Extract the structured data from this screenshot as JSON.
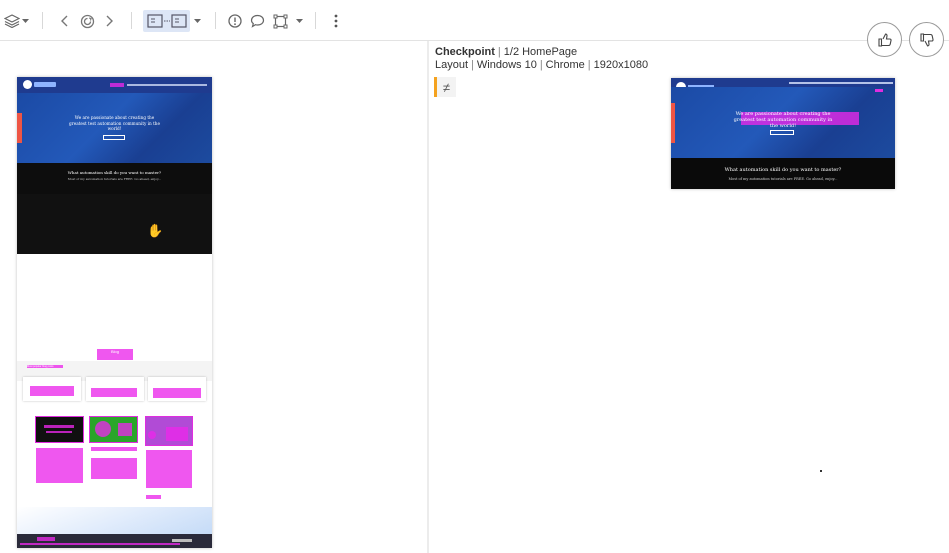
{
  "toolbar": {
    "icons": [
      "layers-icon",
      "chevron-left-icon",
      "refresh-icon",
      "chevron-right-icon",
      "side-by-side-icon",
      "dropdown-arrow-icon",
      "alert-icon",
      "comment-icon",
      "crop-region-icon",
      "more-vert-icon"
    ]
  },
  "feedback": {
    "approve": "thumbs-up-icon",
    "reject": "thumbs-down-icon"
  },
  "checkpoint": {
    "label": "Checkpoint",
    "name": "1/2 HomePage",
    "match_level": "Layout",
    "os": "Windows 10",
    "browser": "Chrome",
    "viewport": "1920x1080",
    "diff_symbol": "≠"
  },
  "baseline": {
    "hero_text": "We are passionate about creating the greatest test automation community in the world!",
    "section_title": "What automation skill do you want to master?",
    "section_sub": "Most of my automation tutorials are FREE. Go ahead, enjoy...",
    "blog_title": "Blog",
    "blog_link": "Most popular blog posts"
  },
  "checkpoint_shot": {
    "hero_text": "We are passionate about creating the greatest test automation community in the world!",
    "section_title": "What automation skill do you want to master?",
    "section_sub": "Most of my automation tutorials are FREE. Go ahead, enjoy..."
  },
  "colors": {
    "highlight": "#eb28eb",
    "accent": "#f4a21f",
    "brand_blue": "#1f3b8f"
  }
}
